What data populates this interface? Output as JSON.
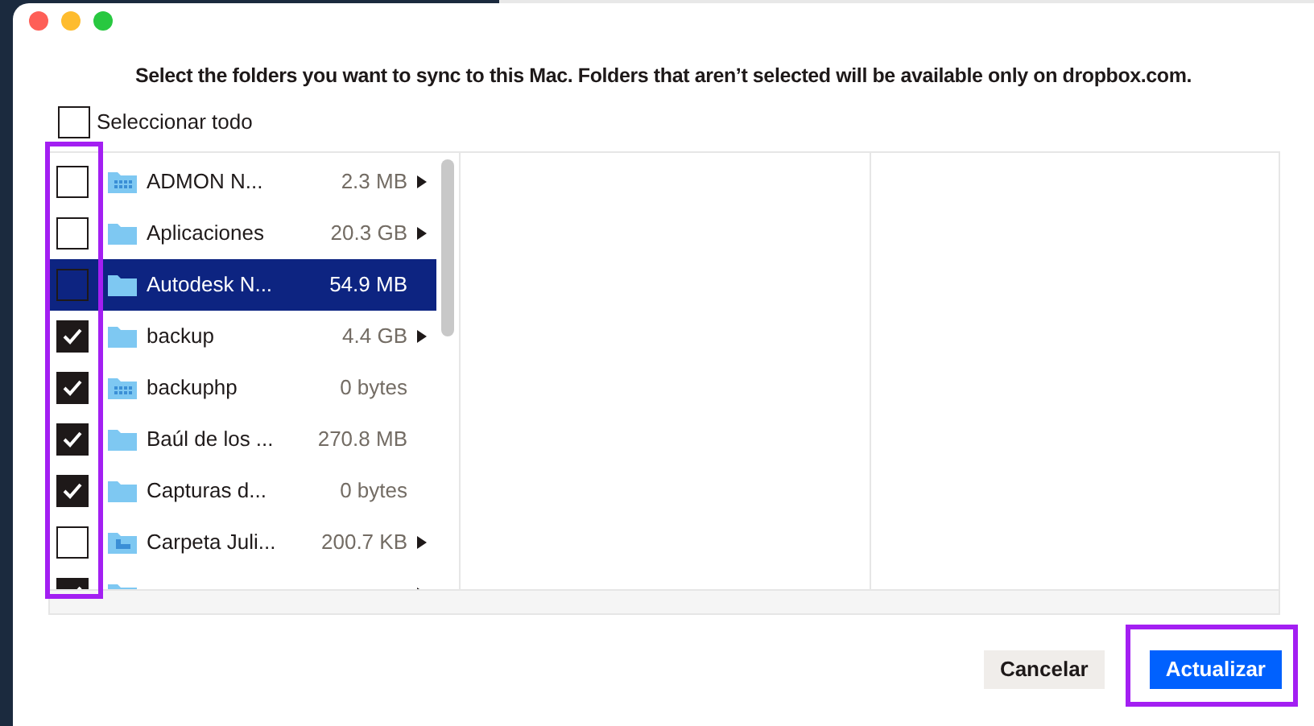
{
  "dialog": {
    "message": "Select the folders you want to sync to this Mac. Folders that aren’t selected will be available only on dropbox.com.",
    "select_all": {
      "label": "Seleccionar todo",
      "checked": false
    }
  },
  "folders": [
    {
      "name": "ADMON N...",
      "size": "2.3 MB",
      "kind": "shared",
      "checked": false,
      "selected": false,
      "expandable": true
    },
    {
      "name": "Aplicaciones",
      "size": "20.3 GB",
      "kind": "folder",
      "checked": false,
      "selected": false,
      "expandable": true
    },
    {
      "name": "Autodesk N...",
      "size": "54.9 MB",
      "kind": "folder",
      "checked": false,
      "selected": true,
      "expandable": false
    },
    {
      "name": "backup",
      "size": "4.4 GB",
      "kind": "folder",
      "checked": true,
      "selected": false,
      "expandable": true
    },
    {
      "name": "backuphp",
      "size": "0 bytes",
      "kind": "shared",
      "checked": true,
      "selected": false,
      "expandable": false
    },
    {
      "name": "Baúl de los ...",
      "size": "270.8 MB",
      "kind": "folder",
      "checked": true,
      "selected": false,
      "expandable": false
    },
    {
      "name": "Capturas d...",
      "size": "0 bytes",
      "kind": "folder",
      "checked": true,
      "selected": false,
      "expandable": false
    },
    {
      "name": "Carpeta Juli...",
      "size": "200.7 KB",
      "kind": "team",
      "checked": false,
      "selected": false,
      "expandable": true
    },
    {
      "kind": "shared",
      "checked": true,
      "selected": false,
      "expandable": true
    }
  ],
  "buttons": [
    {
      "label": "Cancelar",
      "kind": "secondary"
    },
    {
      "label": "Actualizar",
      "kind": "primary"
    }
  ]
}
